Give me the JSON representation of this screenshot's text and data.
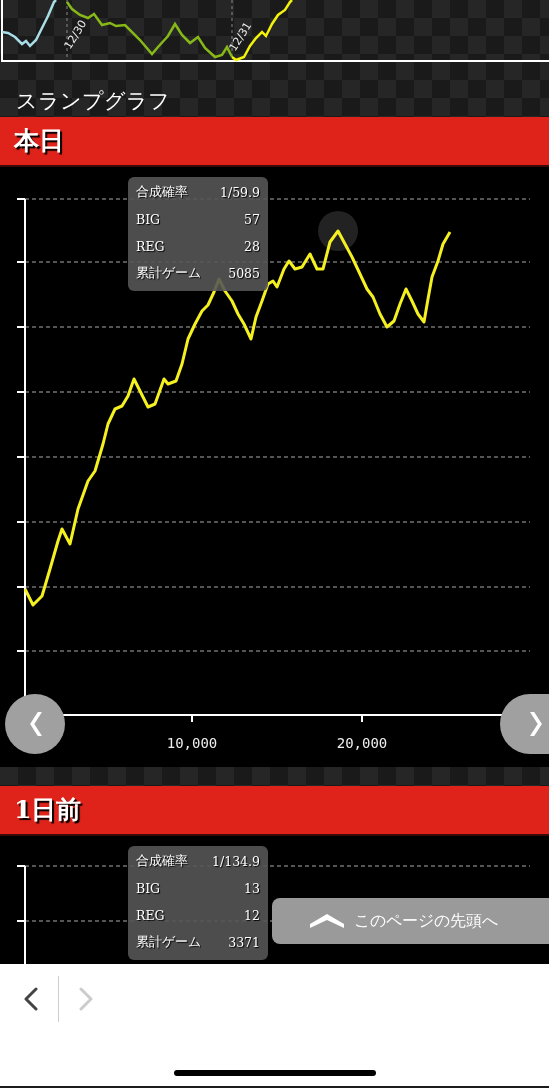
{
  "top_chart": {
    "date_labels": [
      "12/30",
      "12/31"
    ]
  },
  "page_title": "スランプグラフ",
  "sections": [
    {
      "kind": "full",
      "heading": "本日",
      "x_tick_labels": [
        "10,000",
        "20,000"
      ],
      "tooltip": [
        {
          "label": "合成確率",
          "value": "1/59.9"
        },
        {
          "label": "BIG",
          "value": "57"
        },
        {
          "label": "REG",
          "value": "28"
        },
        {
          "label": "累計ゲーム",
          "value": "5085"
        }
      ]
    },
    {
      "kind": "cut",
      "heading": "1日前",
      "tooltip": [
        {
          "label": "合成確率",
          "value": "1/134.9"
        },
        {
          "label": "BIG",
          "value": "13"
        },
        {
          "label": "REG",
          "value": "12"
        },
        {
          "label": "累計ゲーム",
          "value": "3371"
        }
      ]
    }
  ],
  "scroll_top_button": {
    "label": "このページの先頭へ"
  },
  "browser_toolbar": {
    "back": {
      "disabled": false
    },
    "forward": {
      "disabled": true
    }
  }
}
